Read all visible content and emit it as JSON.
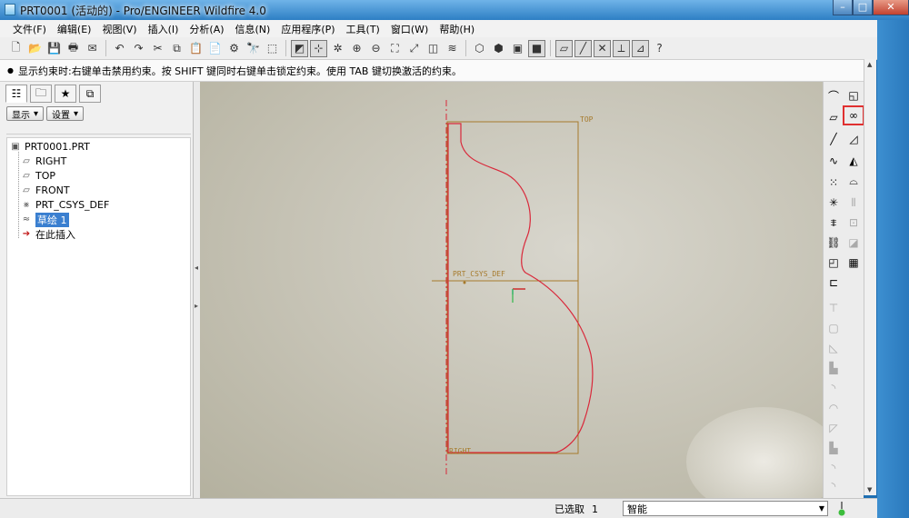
{
  "window": {
    "title": "PRT0001 (活动的) - Pro/ENGINEER Wildfire 4.0",
    "minimize": "–",
    "maximize": "□",
    "close": "✕"
  },
  "menu": [
    "文件(F)",
    "编辑(E)",
    "视图(V)",
    "插入(I)",
    "分析(A)",
    "信息(N)",
    "应用程序(P)",
    "工具(T)",
    "窗口(W)",
    "帮助(H)"
  ],
  "message": {
    "text": "显示约束时:右键单击禁用约束。按 SHIFT 键同时右键单击锁定约束。使用 TAB 键切换激活的约束。"
  },
  "left_panel": {
    "show_btn": "显示",
    "settings_btn": "设置",
    "tree": {
      "root": "PRT0001.PRT",
      "items": [
        "RIGHT",
        "TOP",
        "FRONT",
        "PRT_CSYS_DEF",
        "草绘 1",
        "在此插入"
      ]
    }
  },
  "graphics": {
    "labels": {
      "top": "TOP",
      "csys": "PRT_CSYS_DEF",
      "right": "RIGHT"
    },
    "colors": {
      "datum": "#a67a2c",
      "sketch": "#d9283a",
      "csys_x": "#cc2222",
      "csys_y": "#2fb84a",
      "csys_z": "#3fa9d8"
    }
  },
  "status": {
    "selected_label": "已选取",
    "selected_count": "1",
    "filter_value": "智能"
  },
  "icons": {
    "toolbar": [
      "new-icon",
      "open-icon",
      "save-icon",
      "print-icon",
      "email-icon",
      "undo-icon",
      "redo-icon",
      "cut-icon",
      "copy-icon",
      "paste-icon",
      "paste-special-icon",
      "regenerate-icon",
      "find-icon",
      "select-box-icon",
      "repaint-icon",
      "orient-icon",
      "spin-center-icon",
      "zoom-in-icon",
      "zoom-out-icon",
      "refit-icon",
      "reorient-icon",
      "saved-views-icon",
      "layers-icon",
      "wireframe-icon",
      "hidden-line-icon",
      "no-hidden-icon",
      "shading-icon",
      "datum-planes-icon",
      "datum-axes-icon",
      "datum-points-icon",
      "csys-icon",
      "whats-this-icon"
    ]
  }
}
